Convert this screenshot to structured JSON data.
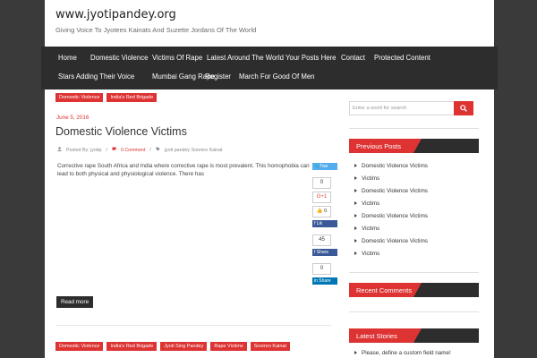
{
  "site": {
    "title": "www.jyotipandey.org",
    "description": "Giving Voice To Jyotees Kainats And Suzette Jordans Of The World"
  },
  "nav": {
    "items": [
      "Home",
      "Domestic Violence",
      "Victims Of Rape",
      "Latest Around The World",
      "Your Posts Here",
      "Contact",
      "Protected Content",
      "Stars Adding Their Voice",
      "Mumbai Gang Rape",
      "Register",
      "March For Good Of Men"
    ]
  },
  "post": {
    "categories": [
      "Domestic Violence",
      "India's Red Brigade"
    ],
    "date": "June 5, 2016",
    "title": "Domestic Violence Victims",
    "author": "Posted By: jyotip",
    "comments": "0 Comment",
    "tags": "jyoti pandey Soomro Kainat",
    "excerpt": "Corrective rape South Africa and India where corrective rape is most prevalent. This homophobia can lead to both physical and physiological violence. There has",
    "read_more": "Read more"
  },
  "next_post": {
    "categories": [
      "Domestic Violence",
      "India's Red Brigade",
      "Jyoti Sing Pandey",
      "Rape Victims",
      "Soomro Kainat"
    ]
  },
  "share": {
    "twitter_label": "Twe",
    "twitter_count": "0",
    "gplus_label": "G+1",
    "gplus_count": "0",
    "fb_like_label": "Lik",
    "fb_like_count": "45",
    "fb_share_label": "Share",
    "fb_share_count": "0",
    "linkedin_label": "Share"
  },
  "sidebar": {
    "search_placeholder": "Enter a word for search",
    "previous_posts_title": "Previous Posts",
    "previous_posts": [
      "Domestic Violence Victims",
      "Victims",
      "Domestic Violence Victims",
      "Victims",
      "Domestic Violence Victims",
      "Victims",
      "Domestic Violence Victims",
      "Victims"
    ],
    "recent_comments_title": "Recent Comments",
    "latest_stories_title": "Latest Stories",
    "latest_stories": [
      "Please, define a custom field name!"
    ]
  },
  "colors": {
    "accent": "#dd3333",
    "nav_bg": "#2d2d2d",
    "page_bg": "#3a3a3a"
  }
}
